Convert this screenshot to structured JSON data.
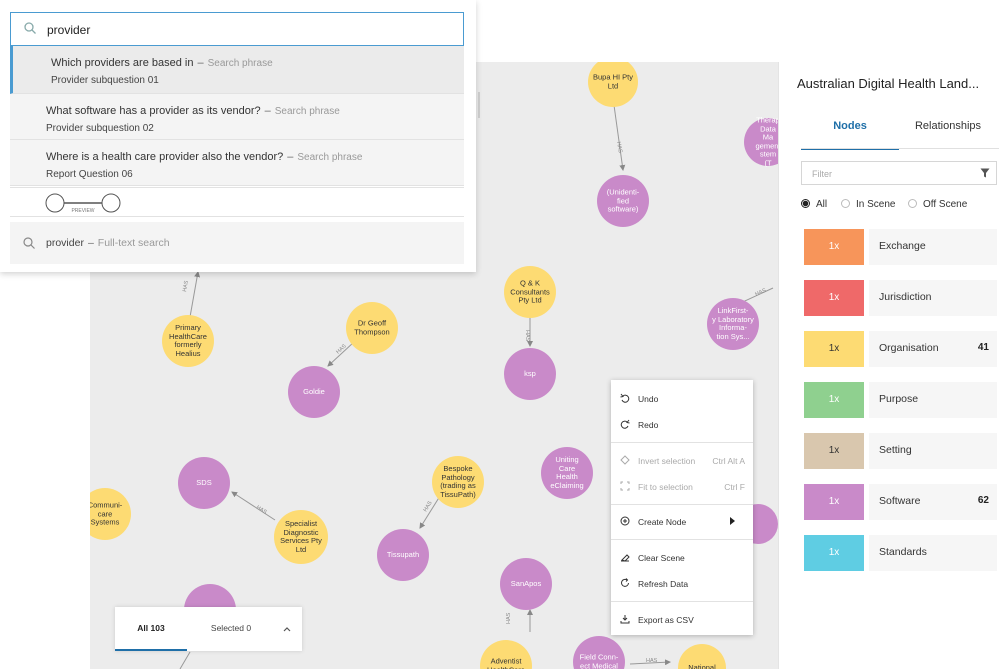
{
  "search": {
    "query": "provider",
    "results": [
      {
        "question": "Which providers are based in",
        "kind": "Search phrase",
        "sub": "Provider subquestion 01"
      },
      {
        "question": "What software has a provider as its vendor?",
        "kind": "Search phrase",
        "sub": "Provider subquestion 02"
      },
      {
        "question": "Where is a health care provider also the vendor?",
        "kind": "Search phrase",
        "sub": "Report Question 06"
      }
    ],
    "dash": "–",
    "preview_label": "PREVIEW",
    "fulltext": {
      "term": "provider",
      "kind": "Full-text search"
    }
  },
  "right_panel": {
    "title": "Australian Digital Health Land...",
    "tabs": {
      "nodes": "Nodes",
      "relationships": "Relationships"
    },
    "filter_placeholder": "Filter",
    "radios": {
      "all": "All",
      "in_scene": "In Scene",
      "off_scene": "Off Scene"
    },
    "categories": [
      {
        "label": "Exchange",
        "multiplier": "1x",
        "count": "",
        "color": "#f7955a"
      },
      {
        "label": "Jurisdiction",
        "multiplier": "1x",
        "count": "",
        "color": "#ef6969"
      },
      {
        "label": "Organisation",
        "multiplier": "1x",
        "count": "41",
        "color": "#fddb73"
      },
      {
        "label": "Purpose",
        "multiplier": "1x",
        "count": "",
        "color": "#8fd08f"
      },
      {
        "label": "Setting",
        "multiplier": "1x",
        "count": "",
        "color": "#d9c7ae"
      },
      {
        "label": "Software",
        "multiplier": "1x",
        "count": "62",
        "color": "#c98ac9"
      },
      {
        "label": "Standards",
        "multiplier": "1x",
        "count": "",
        "color": "#5fcde3"
      }
    ]
  },
  "context_menu": {
    "undo": "Undo",
    "redo": "Redo",
    "invert_selection": "Invert selection",
    "invert_shortcut": "Ctrl Alt A",
    "fit_to_selection": "Fit to selection",
    "fit_shortcut": "Ctrl F",
    "create_node": "Create Node",
    "clear_scene": "Clear Scene",
    "refresh_data": "Refresh Data",
    "export_csv": "Export as CSV"
  },
  "bottom_bar": {
    "all": "All 103",
    "selected": "Selected 0"
  },
  "graph": {
    "rel_label": "HAS",
    "nodes": [
      {
        "label": "Bupa HI Pty\nLtd",
        "type": "org"
      },
      {
        "label": "(Unidenti-\nfied\nsoftware)",
        "type": "sw"
      },
      {
        "label": "Therap\nData Ma\ngement\nstem (T",
        "type": "sw"
      },
      {
        "label": "Q & K\nConsultants\nPty Ltd",
        "type": "org"
      },
      {
        "label": "ksp",
        "type": "sw"
      },
      {
        "label": "LinkFirst-\ny Laboratory\nInforma-\ntion Sys...",
        "type": "sw"
      },
      {
        "label": "Primary\nHealthCare\nformerly\nHealius",
        "type": "org"
      },
      {
        "label": "Dr Geoff\nThompson",
        "type": "org"
      },
      {
        "label": "Goldie",
        "type": "sw"
      },
      {
        "label": "SDS",
        "type": "sw"
      },
      {
        "label": "Specialist\nDiagnostic\nServices Pty\nLtd",
        "type": "org"
      },
      {
        "label": "Bespoke\nPathology\n(trading as\nTissuPath)",
        "type": "org"
      },
      {
        "label": "Tissupath",
        "type": "sw"
      },
      {
        "label": "Uniting\nCare\nHealth\neClaiming",
        "type": "sw"
      },
      {
        "label": "SanApos",
        "type": "sw"
      },
      {
        "label": "Communi-\ncare\nSystems",
        "type": "org"
      },
      {
        "label": "Adventist\nHealthCare",
        "type": "org"
      },
      {
        "label": "Field Conn-\nect Medical",
        "type": "sw"
      },
      {
        "label": "National",
        "type": "org"
      },
      {
        "label": "",
        "type": "sw"
      },
      {
        "label": "",
        "type": "sw"
      },
      {
        "label": "",
        "type": "org"
      },
      {
        "label": "",
        "type": "sw"
      },
      {
        "label": "",
        "type": "sw"
      }
    ]
  }
}
